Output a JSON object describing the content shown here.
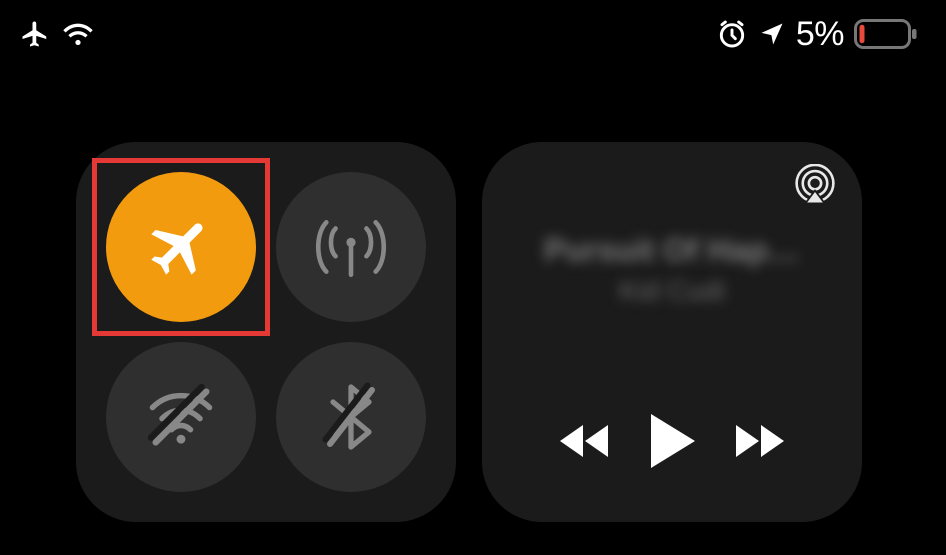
{
  "status_bar": {
    "airplane_mode": true,
    "wifi_active": true,
    "alarm_set": true,
    "location_active": true,
    "battery_percent_label": "5%",
    "battery_level": 5,
    "battery_low": true
  },
  "connectivity": {
    "airplane_mode": {
      "active": true,
      "highlighted": true
    },
    "cellular": {
      "active": false
    },
    "wifi": {
      "active": false
    },
    "bluetooth": {
      "active": false
    }
  },
  "media": {
    "title": "Pursuit Of Hap…",
    "artist": "Kid Cudi",
    "playing": false
  },
  "colors": {
    "airplane_active": "#f39b0e",
    "highlight": "#e53935",
    "panel": "#1b1b1b",
    "battery_low": "#e84b3c"
  }
}
